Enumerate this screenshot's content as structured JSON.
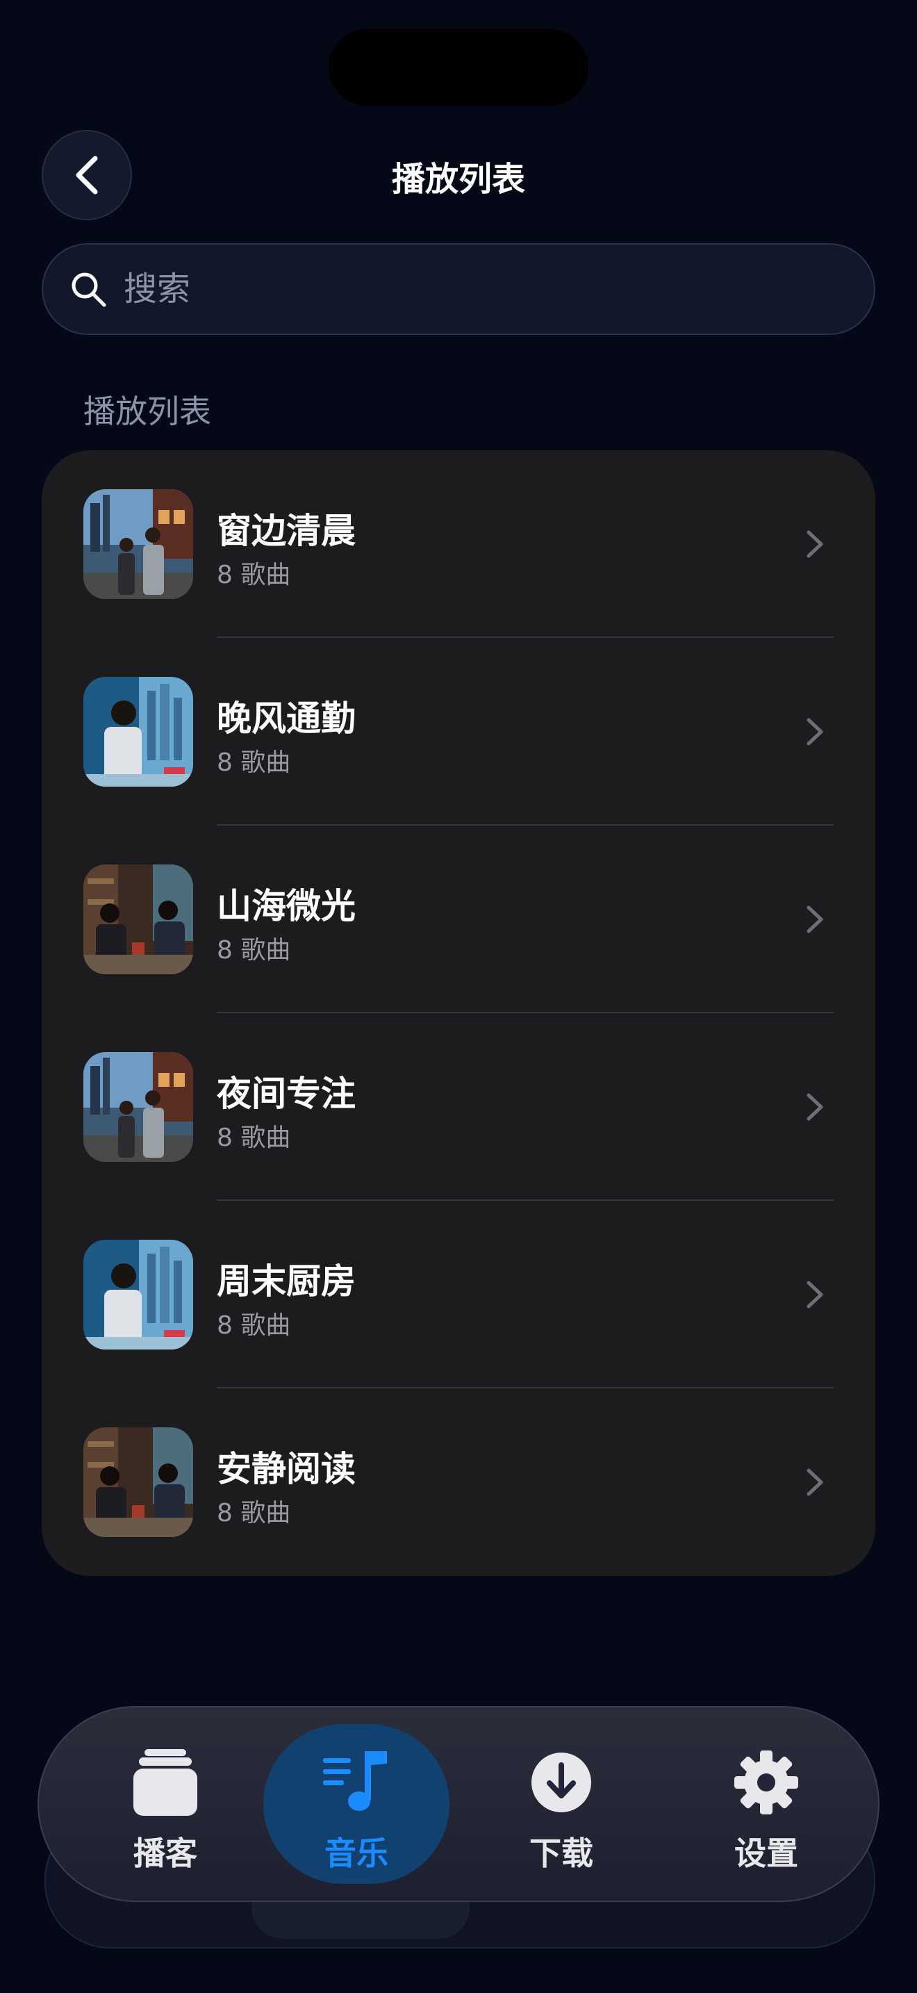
{
  "header": {
    "title": "播放列表"
  },
  "search": {
    "placeholder": "搜索"
  },
  "section": {
    "label": "播放列表"
  },
  "playlists": [
    {
      "title": "窗边清晨",
      "subtitle": "8 歌曲",
      "thumb": "street-couple"
    },
    {
      "title": "晚风通勤",
      "subtitle": "8 歌曲",
      "thumb": "lab-skyline"
    },
    {
      "title": "山海微光",
      "subtitle": "8 歌曲",
      "thumb": "podcast-studio"
    },
    {
      "title": "夜间专注",
      "subtitle": "8 歌曲",
      "thumb": "street-couple"
    },
    {
      "title": "周末厨房",
      "subtitle": "8 歌曲",
      "thumb": "lab-skyline"
    },
    {
      "title": "安静阅读",
      "subtitle": "8 歌曲",
      "thumb": "podcast-studio"
    }
  ],
  "tabs": [
    {
      "label": "播客",
      "icon": "stack-icon",
      "active": false
    },
    {
      "label": "音乐",
      "icon": "music-note-icon",
      "active": true
    },
    {
      "label": "下载",
      "icon": "download-icon",
      "active": false
    },
    {
      "label": "设置",
      "icon": "gear-icon",
      "active": false
    }
  ],
  "colors": {
    "accent": "#1a8cff",
    "background": "#050816",
    "card": "#1c1c1e"
  }
}
